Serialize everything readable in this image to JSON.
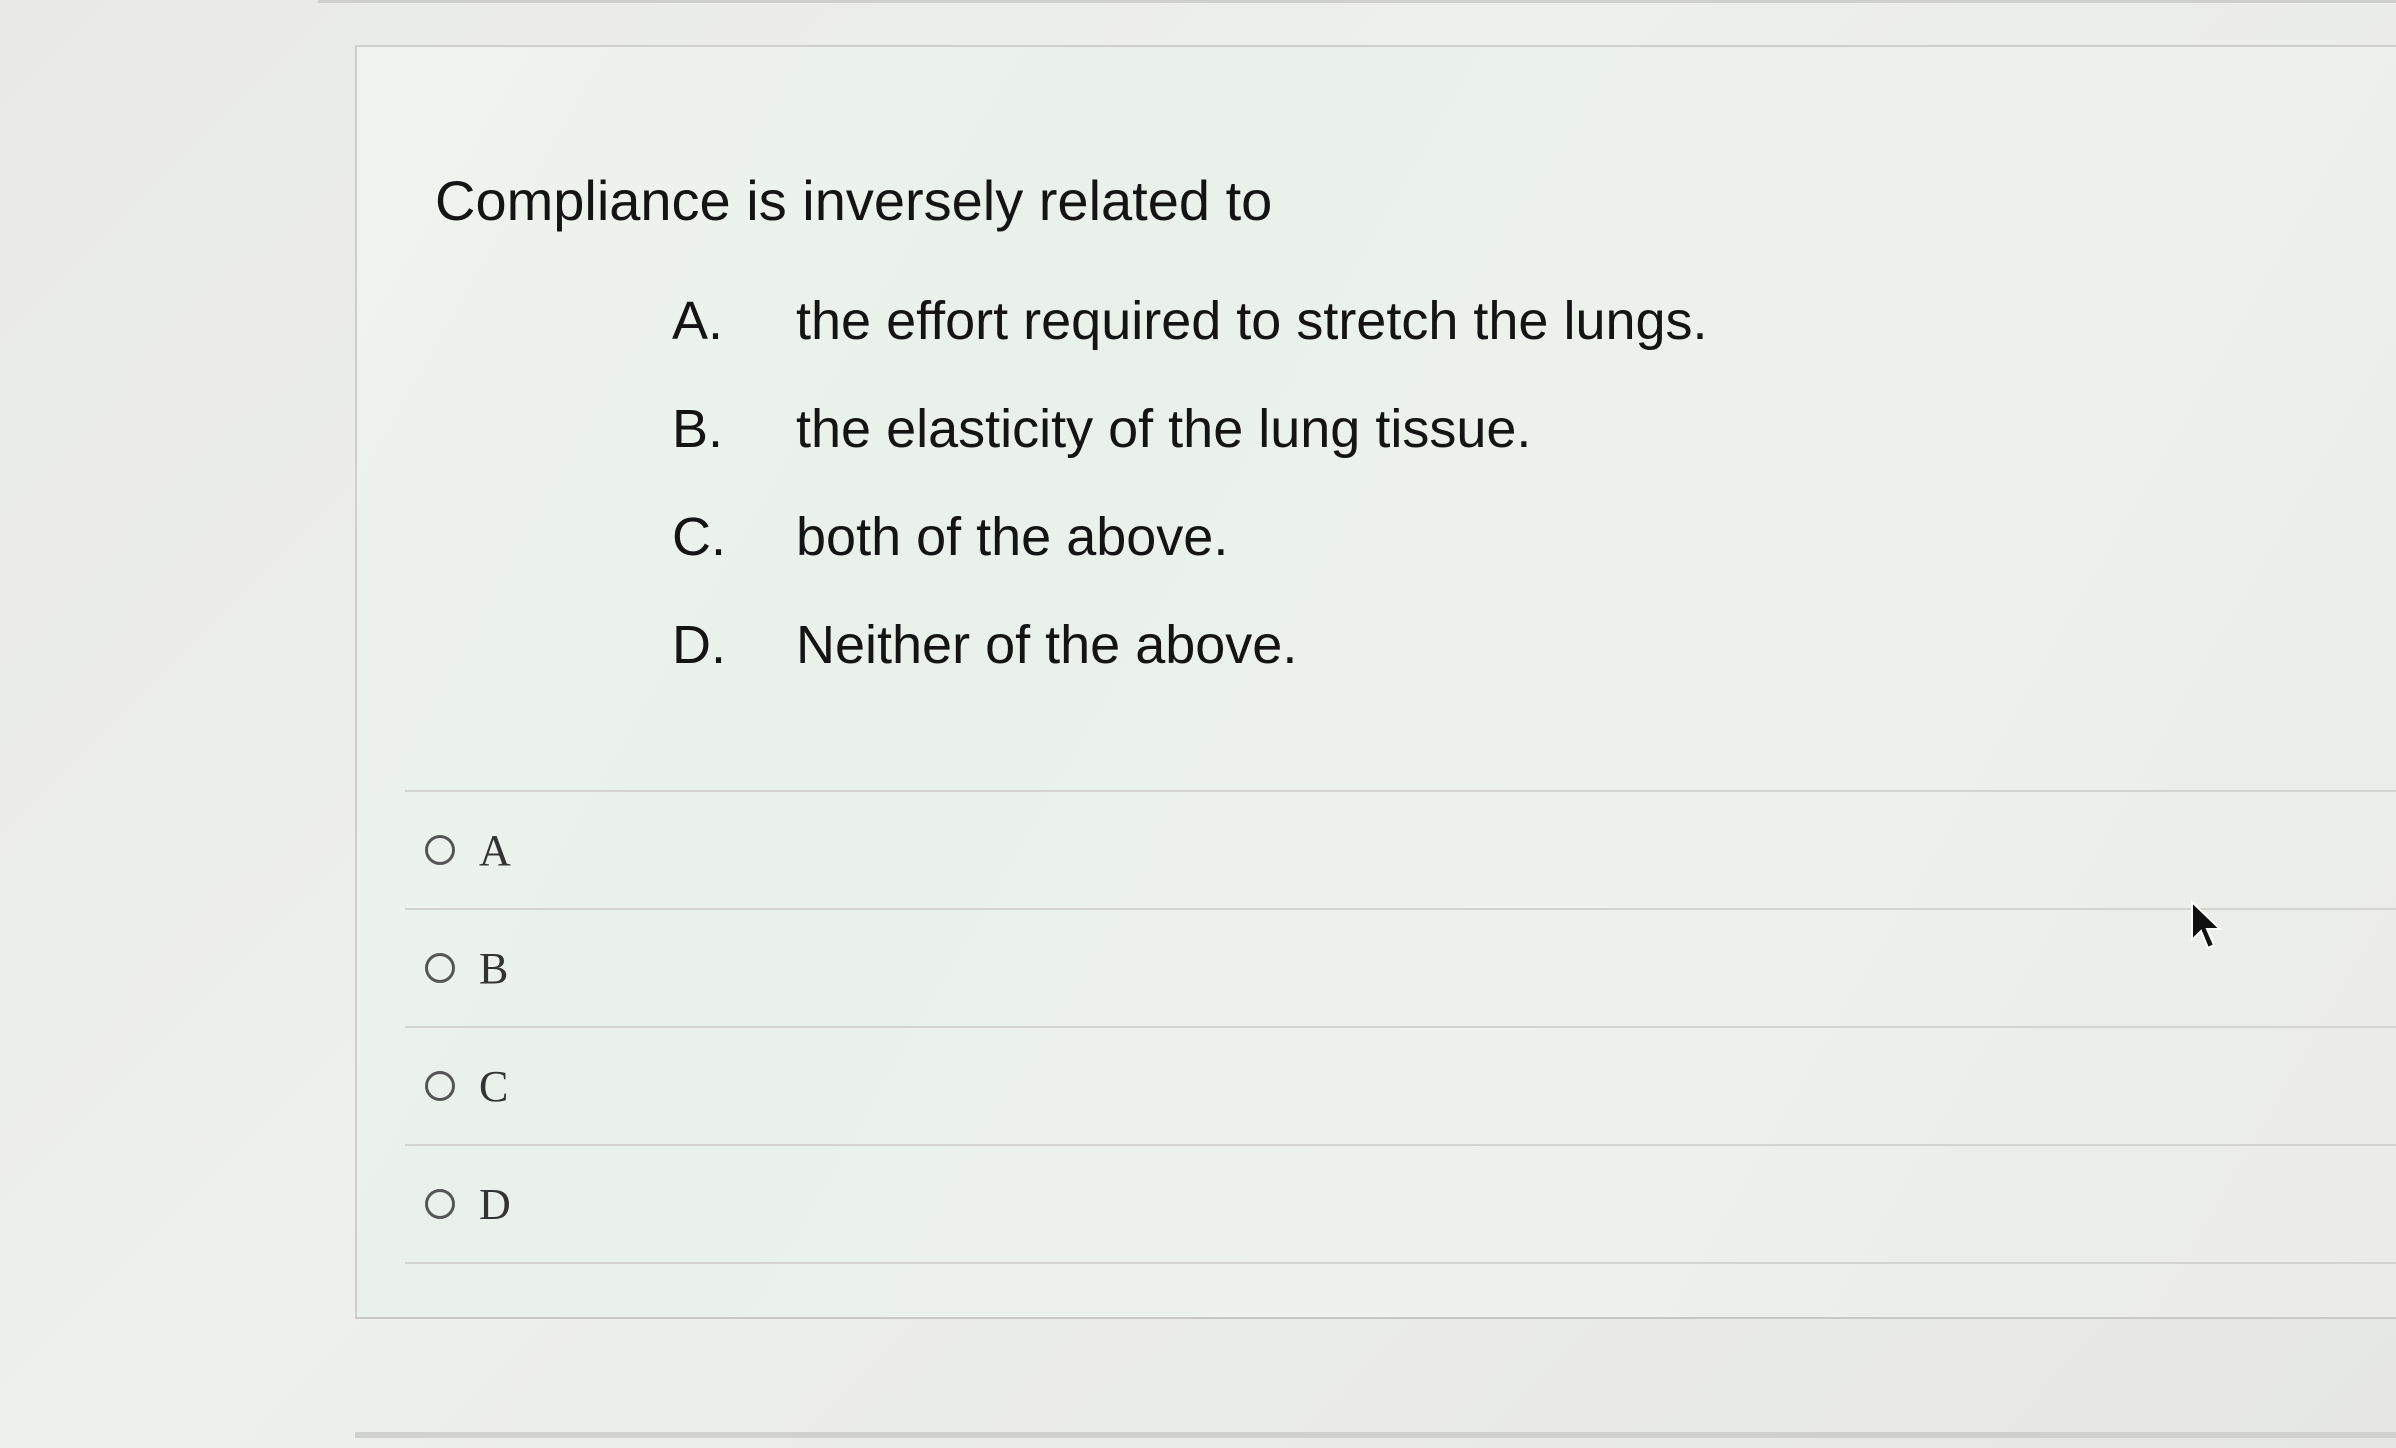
{
  "question": {
    "text": "Compliance is inversely related to"
  },
  "options": [
    {
      "letter": "A.",
      "text": "the effort required to stretch the lungs."
    },
    {
      "letter": "B.",
      "text": "the elasticity of the lung tissue."
    },
    {
      "letter": "C.",
      "text": "both of the above."
    },
    {
      "letter": "D.",
      "text": "Neither of the above."
    }
  ],
  "choices": [
    {
      "label": "A"
    },
    {
      "label": "B"
    },
    {
      "label": "C"
    },
    {
      "label": "D"
    }
  ],
  "icons": {
    "radio": "radio-unselected-icon",
    "cursor": "mouse-pointer-icon"
  }
}
